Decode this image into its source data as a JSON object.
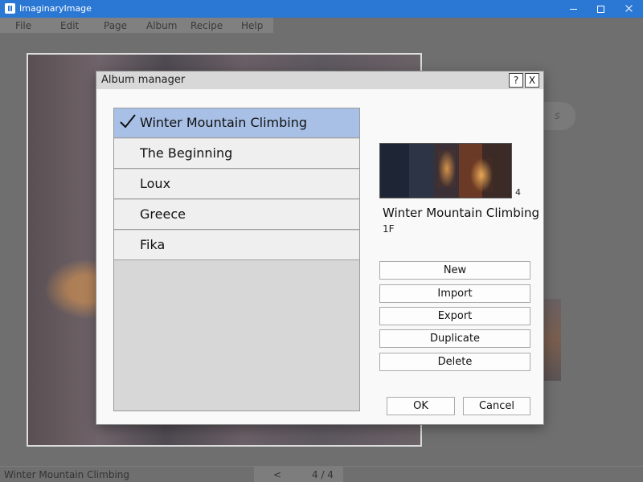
{
  "app": {
    "title": "ImaginaryImage"
  },
  "menu": [
    "File",
    "Edit",
    "Page",
    "Album",
    "Recipe",
    "Help"
  ],
  "background": {
    "hint_text": "s"
  },
  "status": {
    "album": "Winter Mountain Climbing",
    "prev": "<",
    "page": "4 / 4"
  },
  "dialog": {
    "title": "Album manager",
    "help": "?",
    "close": "X",
    "albums": [
      {
        "label": "Winter Mountain Climbing",
        "selected": true
      },
      {
        "label": "The Beginning",
        "selected": false
      },
      {
        "label": "Loux",
        "selected": false
      },
      {
        "label": "Greece",
        "selected": false
      },
      {
        "label": "Fika",
        "selected": false
      }
    ],
    "preview": {
      "count": "4",
      "name": "Winter Mountain Climbing",
      "sub": "1F"
    },
    "actions": [
      "New",
      "Import",
      "Export",
      "Duplicate",
      "Delete"
    ],
    "ok": "OK",
    "cancel": "Cancel"
  }
}
